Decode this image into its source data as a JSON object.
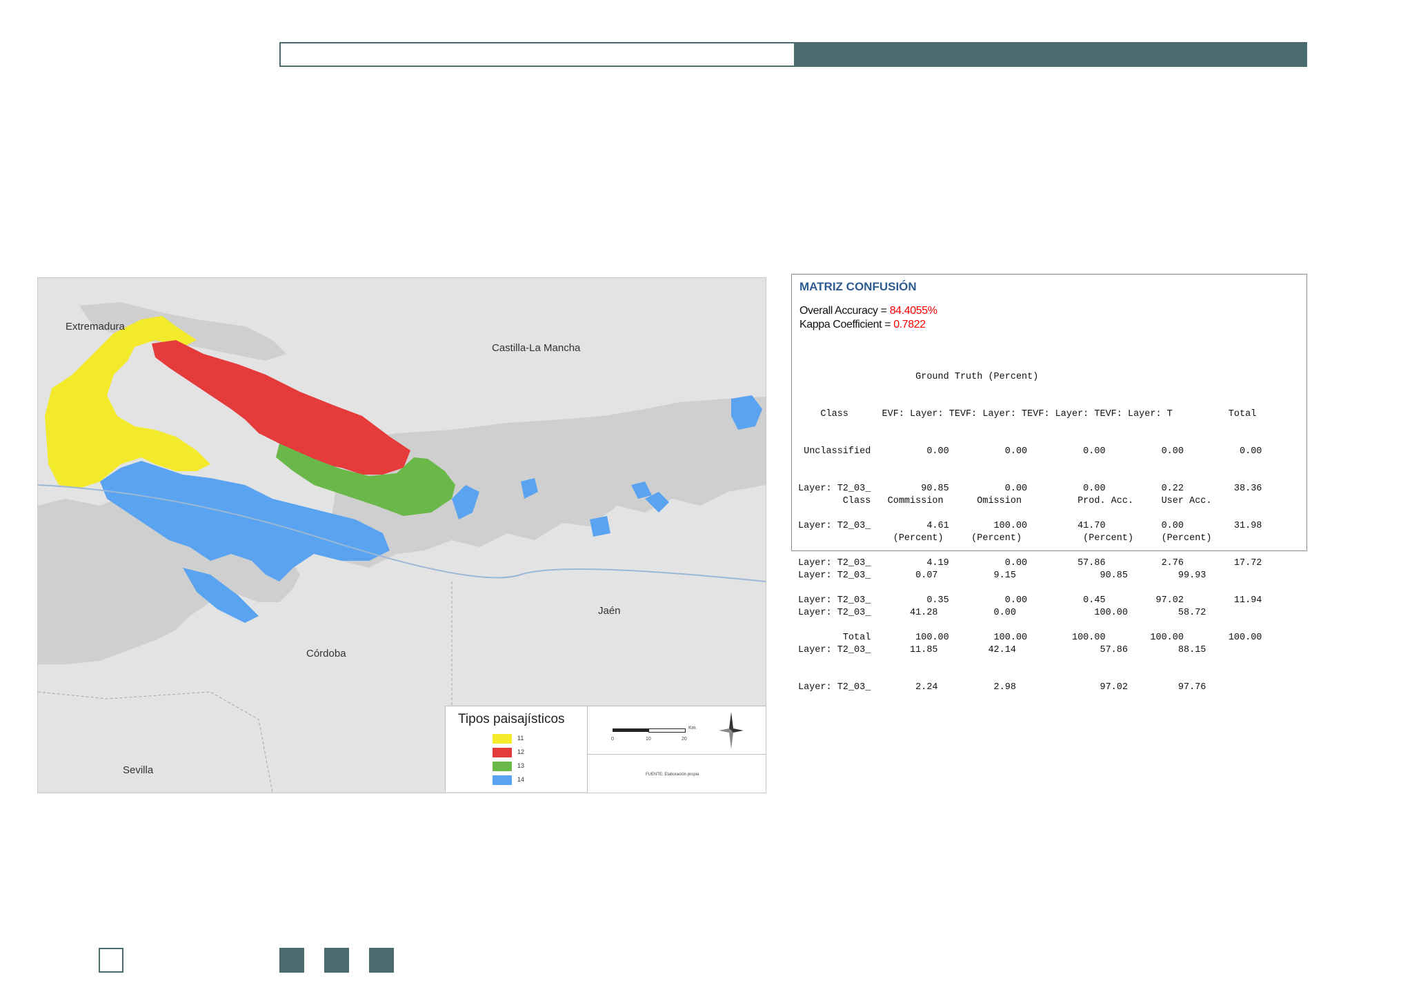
{
  "map": {
    "regions": {
      "extremadura": "Extremadura",
      "castilla": "Castilla-La Mancha",
      "jaen": "Jaén",
      "cordoba": "Córdoba",
      "sevilla": "Sevilla"
    },
    "legend": {
      "title": "Tipos paisajísticos",
      "items": [
        {
          "label": "11",
          "color": "#f2ea2a"
        },
        {
          "label": "12",
          "color": "#e63b3b"
        },
        {
          "label": "13",
          "color": "#6ab84a"
        },
        {
          "label": "14",
          "color": "#5aa3f0"
        }
      ]
    },
    "scale": {
      "ticks": [
        "0",
        "10",
        "20"
      ],
      "unit": "Km."
    },
    "source": "FUENTE: Elaboración propia"
  },
  "confusion_matrix": {
    "title": "MATRIZ CONFUSIÓN",
    "overall_label": "Overall Accuracy = ",
    "overall_value": "84.4055%",
    "kappa_label": "Kappa Coefficient = ",
    "kappa_value": "0.7822",
    "ground_truth_lines": [
      "                     Ground Truth (Percent)",
      "    Class      EVF: Layer: TEVF: Layer: TEVF: Layer: TEVF: Layer: T          Total",
      " Unclassified          0.00          0.00          0.00          0.00          0.00",
      "Layer: T2_03_         90.85          0.00          0.00          0.22         38.36",
      "Layer: T2_03_          4.61        100.00         41.70          0.00         31.98",
      "Layer: T2_03_          4.19          0.00         57.86          2.76         17.72",
      "Layer: T2_03_          0.35          0.00          0.45         97.02         11.94",
      "        Total        100.00        100.00        100.00        100.00        100.00"
    ],
    "accuracy_lines": [
      "        Class   Commission      Omission          Prod. Acc.     User Acc.",
      "                 (Percent)     (Percent)           (Percent)     (Percent)",
      "Layer: T2_03_        0.07          9.15               90.85         99.93",
      "Layer: T2_03_       41.28          0.00              100.00         58.72",
      "Layer: T2_03_       11.85         42.14               57.86         88.15",
      "Layer: T2_03_        2.24          2.98               97.02         97.76"
    ]
  },
  "colors": {
    "accent": "#4a6b70",
    "title_blue": "#2e5b90",
    "value_red": "#ff0000"
  }
}
